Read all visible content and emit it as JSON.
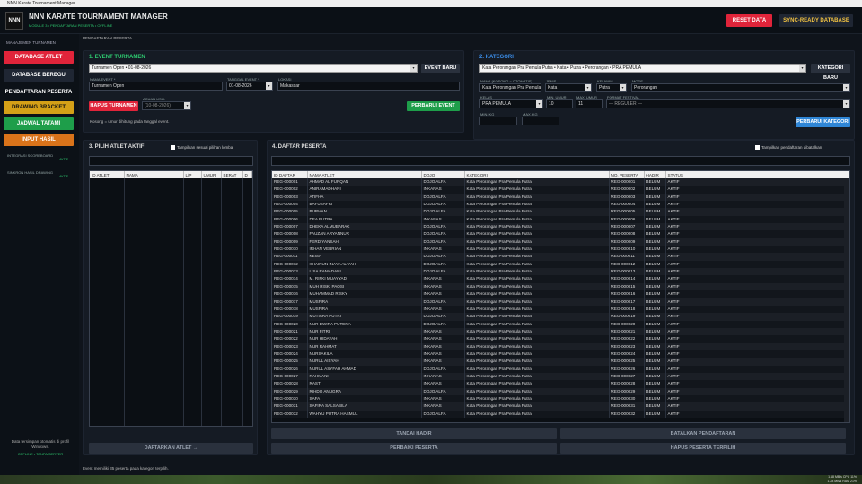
{
  "window": {
    "title": "NNN Karate Tournament Manager"
  },
  "header": {
    "logo": "NNN",
    "title": "NNN KARATE TOURNAMENT MANAGER",
    "subtitle": "MODULE 3 • PENDAFTARAN PESERTA • OFFLINE",
    "reset": "RESET DATA",
    "sync": "SYNC-READY DATABASE"
  },
  "sidebar": {
    "heading": "MANAJEMEN TURNAMEN",
    "items": [
      {
        "label": "DATABASE ATLET",
        "color": "#e0243a"
      },
      {
        "label": "DATABASE BEREGU",
        "color": "#1f2633"
      },
      {
        "label": "PENDAFTARAN PESERTA",
        "color": "#0c1117"
      },
      {
        "label": "DRAWING  BRACKET",
        "color": "#d4a017"
      },
      {
        "label": "JADWAL  TATAMI",
        "color": "#1e9e4a"
      },
      {
        "label": "INPUT HASIL",
        "color": "#d9731a"
      }
    ],
    "extras": [
      {
        "label": "INTEGRASI SCOREBOARD",
        "state": "AKTIF"
      },
      {
        "label": "SINKRON HASIL  DRAWING",
        "state": "AKTIF"
      }
    ],
    "footer1": "Data tersimpan otomatis di profil Windows.",
    "footer2": "OFFLINE • TANPA SERVER"
  },
  "breadcrumb": "PENDAFTARAN PESERTA",
  "event": {
    "title": "1. EVENT TURNAMEN",
    "selected": "Turnamen Open • 01-08-2026",
    "new_btn": "EVENT BARU",
    "name_label": "NAMA EVENT *",
    "name": "Turnamen Open",
    "date_label": "TANGGAL EVENT *",
    "date": "01-08-2026",
    "loc_label": "LOKASI",
    "loc": "Makassar",
    "ref_label": "ACUAN USIA",
    "ref": "(10-08-2026)",
    "delete_btn": "HAPUS TURNAMEN",
    "update_btn": "PERBARUI EVENT",
    "hint": "Kosong = umur dihitung pada tanggal event."
  },
  "kategori": {
    "title": "2. KATEGORI",
    "selected": "Kata Perorangan Pra Pemula Putra • Kata • Putra • Perorangan • PRA PEMULA",
    "new_btn": "KATEGORI BARU",
    "name_label": "NAMA (KOSONG = OTOMATIS)",
    "name": "Kata Perorangan Pra Pemula Putra",
    "jenis_label": "JENIS",
    "jenis": "Kata",
    "kelamin_label": "KELAMIN",
    "kelamin": "Putra",
    "mode_label": "MODE",
    "mode": "Perorangan",
    "kelas_label": "KELAS",
    "kelas": "PRA PEMULA",
    "min_umur_label": "MIN. UMUR",
    "min_umur": "10",
    "max_umur_label": "MAX. UMUR",
    "max_umur": "11",
    "format_label": "FORMAT FESTIVAL",
    "format": "— REGULER —",
    "min_kg_label": "MIN. KG",
    "max_kg_label": "MAX. KG",
    "update_btn": "PERBARUI KATEGORI"
  },
  "atlet": {
    "title": "3. PILIH ATLET AKTIF",
    "check": "Tampilkan sesuai pilihan lomba",
    "columns": [
      "ID ATLET",
      "NAMA",
      "L/P",
      "UMUR",
      "BERAT",
      "D"
    ],
    "register_btn": "DAFTARKAN ATLET →"
  },
  "peserta": {
    "title": "4. DAFTAR PESERTA",
    "check": "Tampilkan pendaftaran dibatalkan",
    "columns": [
      "ID DAFTAR",
      "NAMA ATLET",
      "DOJO",
      "KATEGORI",
      "NO. PESERTA",
      "HADIR",
      "STATUS"
    ],
    "rows": [
      [
        "REG-000001",
        "AHMAD AL FURQAN",
        "DOJO ALFA",
        "Kata Perorangan Pra Pemula Putra",
        "REG-000001",
        "BELUM",
        "AKTIF"
      ],
      [
        "REG-000002",
        "ANIRAMADHANI",
        "INKANAS",
        "Kata Perorangan Pra Pemula Putra",
        "REG-000002",
        "BELUM",
        "AKTIF"
      ],
      [
        "REG-000003",
        "ATIFHA",
        "DOJO ALFA",
        "Kata Perorangan Pra Pemula Putra",
        "REG-000003",
        "BELUM",
        "AKTIF"
      ],
      [
        "REG-000004",
        "BAYUSAFRI",
        "DOJO ALFA",
        "Kata Perorangan Pra Pemula Putra",
        "REG-000004",
        "BELUM",
        "AKTIF"
      ],
      [
        "REG-000005",
        "BURHAN",
        "DOJO ALFA",
        "Kata Perorangan Pra Pemula Putra",
        "REG-000005",
        "BELUM",
        "AKTIF"
      ],
      [
        "REG-000006",
        "DEA PUTRA",
        "INKANAS",
        "Kata Perorangan Pra Pemula Putra",
        "REG-000006",
        "BELUM",
        "AKTIF"
      ],
      [
        "REG-000007",
        "DHEKA ALMUBARAK",
        "DOJO ALFA",
        "Kata Perorangan Pra Pemula Putra",
        "REG-000007",
        "BELUM",
        "AKTIF"
      ],
      [
        "REG-000008",
        "FAUZAN ARYANNUR",
        "DOJO ALFA",
        "Kata Perorangan Pra Pemula Putra",
        "REG-000008",
        "BELUM",
        "AKTIF"
      ],
      [
        "REG-000009",
        "FERDIYANSAH",
        "DOJO ALFA",
        "Kata Perorangan Pra Pemula Putra",
        "REG-000009",
        "BELUM",
        "AKTIF"
      ],
      [
        "REG-000010",
        "IRHAN VEBRIAN",
        "INKANAS",
        "Kata Perorangan Pra Pemula Putra",
        "REG-000010",
        "BELUM",
        "AKTIF"
      ],
      [
        "REG-000011",
        "KEISA",
        "DOJO ALFA",
        "Kata Perorangan Pra Pemula Putra",
        "REG-000011",
        "BELUM",
        "AKTIF"
      ],
      [
        "REG-000012",
        "KHAIRUN INAYA ALIYAH",
        "DOJO ALFA",
        "Kata Perorangan Pra Pemula Putra",
        "REG-000012",
        "BELUM",
        "AKTIF"
      ],
      [
        "REG-000013",
        "LISA RAMADANI",
        "DOJO ALFA",
        "Kata Perorangan Pra Pemula Putra",
        "REG-000013",
        "BELUM",
        "AKTIF"
      ],
      [
        "REG-000014",
        "M. RIFKI MUAYYADI",
        "INKANAS",
        "Kata Perorangan Pra Pemula Putra",
        "REG-000014",
        "BELUM",
        "AKTIF"
      ],
      [
        "REG-000015",
        "MUH RISKI PAOSI",
        "INKANAS",
        "Kata Perorangan Pra Pemula Putra",
        "REG-000015",
        "BELUM",
        "AKTIF"
      ],
      [
        "REG-000016",
        "MUHAMMAD RISKY",
        "INKANAS",
        "Kata Perorangan Pra Pemula Putra",
        "REG-000016",
        "BELUM",
        "AKTIF"
      ],
      [
        "REG-000017",
        "MUSFIRA",
        "DOJO ALFA",
        "Kata Perorangan Pra Pemula Putra",
        "REG-000017",
        "BELUM",
        "AKTIF"
      ],
      [
        "REG-000018",
        "MUSFIRA",
        "INKANAS",
        "Kata Perorangan Pra Pemula Putra",
        "REG-000018",
        "BELUM",
        "AKTIF"
      ],
      [
        "REG-000019",
        "MUTIARA PUTRI",
        "DOJO ALFA",
        "Kata Perorangan Pra Pemula Putra",
        "REG-000019",
        "BELUM",
        "AKTIF"
      ],
      [
        "REG-000020",
        "NUR DWIRA PUTERA",
        "DOJO ALFA",
        "Kata Perorangan Pra Pemula Putra",
        "REG-000020",
        "BELUM",
        "AKTIF"
      ],
      [
        "REG-000021",
        "NUR FITRI",
        "INKANAS",
        "Kata Perorangan Pra Pemula Putra",
        "REG-000021",
        "BELUM",
        "AKTIF"
      ],
      [
        "REG-000022",
        "NUR HIDAYAH",
        "INKANAS",
        "Kata Perorangan Pra Pemula Putra",
        "REG-000022",
        "BELUM",
        "AKTIF"
      ],
      [
        "REG-000023",
        "NUR RAHMAT",
        "INKANAS",
        "Kata Perorangan Pra Pemula Putra",
        "REG-000023",
        "BELUM",
        "AKTIF"
      ],
      [
        "REG-000024",
        "NURSAKILA",
        "INKANAS",
        "Kata Perorangan Pra Pemula Putra",
        "REG-000024",
        "BELUM",
        "AKTIF"
      ],
      [
        "REG-000025",
        "NURUL AISYAH",
        "INKANAS",
        "Kata Perorangan Pra Pemula Putra",
        "REG-000025",
        "BELUM",
        "AKTIF"
      ],
      [
        "REG-000026",
        "NURUL ASYFAH AHMAD",
        "DOJO ALFA",
        "Kata Perorangan Pra Pemula Putra",
        "REG-000026",
        "BELUM",
        "AKTIF"
      ],
      [
        "REG-000027",
        "RAHMANI",
        "INKANAS",
        "Kata Perorangan Pra Pemula Putra",
        "REG-000027",
        "BELUM",
        "AKTIF"
      ],
      [
        "REG-000028",
        "RASTI",
        "INKANAS",
        "Kata Perorangan Pra Pemula Putra",
        "REG-000028",
        "BELUM",
        "AKTIF"
      ],
      [
        "REG-000029",
        "RIHDO ANUGRA",
        "DOJO ALFA",
        "Kata Perorangan Pra Pemula Putra",
        "REG-000029",
        "BELUM",
        "AKTIF"
      ],
      [
        "REG-000030",
        "SAFA",
        "INKANAS",
        "Kata Perorangan Pra Pemula Putra",
        "REG-000030",
        "BELUM",
        "AKTIF"
      ],
      [
        "REG-000031",
        "SAFIRA SALSABILA",
        "INKANAS",
        "Kata Perorangan Pra Pemula Putra",
        "REG-000031",
        "BELUM",
        "AKTIF"
      ],
      [
        "REG-000032",
        "WAHYU PUTRA HASMUL",
        "DOJO ALFA",
        "Kata Perorangan Pra Pemula Putra",
        "REG-000032",
        "BELUM",
        "AKTIF"
      ]
    ],
    "btn_hadir": "TANDAI HADIR",
    "btn_batal": "BATALKAN PENDAFTARAN",
    "btn_perbaiki": "PERBAIKI PESERTA",
    "btn_hapus": "HAPUS PESERTA TERPILIH"
  },
  "status": "Event memiliki 35 peserta pada kategori terpilih.",
  "tray": {
    "line1": "1.18 MB/s  CPU 11%",
    "line2": "1.28 MB/s  RAM 21%"
  }
}
